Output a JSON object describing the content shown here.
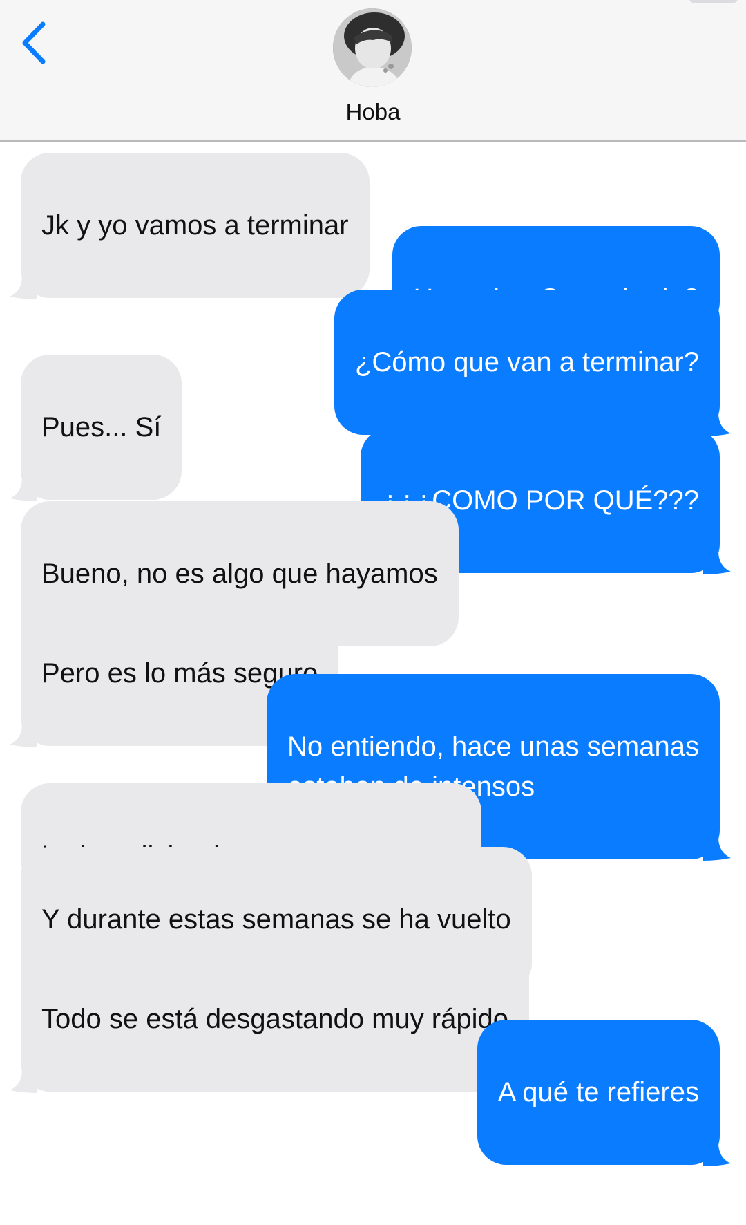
{
  "header": {
    "contact_name": "Hoba",
    "back_icon": "chevron-left-icon"
  },
  "colors": {
    "incoming_bubble": "#e9e9eb",
    "outgoing_bubble": "#0a7cff",
    "header_bg": "#f6f6f7",
    "accent": "#0a7cff"
  },
  "messages": [
    {
      "direction": "in",
      "text": "Jk y yo vamos a terminar",
      "tail": true
    },
    {
      "direction": "out",
      "text": "Hoseok, ¿Que mierda?",
      "tail": false
    },
    {
      "direction": "out",
      "text": "¿Cómo que van a terminar?",
      "tail": true
    },
    {
      "direction": "in",
      "text": "Pues... Sí",
      "tail": true
    },
    {
      "direction": "out",
      "text": "¿¿¿COMO POR QUÉ???",
      "tail": true
    },
    {
      "direction": "in",
      "text": "Bueno, no es algo que hayamos\ndecidido... todavía",
      "tail": false
    },
    {
      "direction": "in",
      "text": "Pero es lo más seguro",
      "tail": true
    },
    {
      "direction": "out",
      "text": "No entiendo, hace unas semanas\nestaban de intensos",
      "tail": true
    },
    {
      "direction": "in",
      "text": "Lo has dicho, hace unas semanas",
      "tail": false
    },
    {
      "direction": "in",
      "text": "Y durante estas semanas se ha vuelto\nun caos",
      "tail": false
    },
    {
      "direction": "in",
      "text": "Todo se está desgastando muy rápido",
      "tail": true
    },
    {
      "direction": "out",
      "text": "A qué te refieres",
      "tail": true
    }
  ]
}
